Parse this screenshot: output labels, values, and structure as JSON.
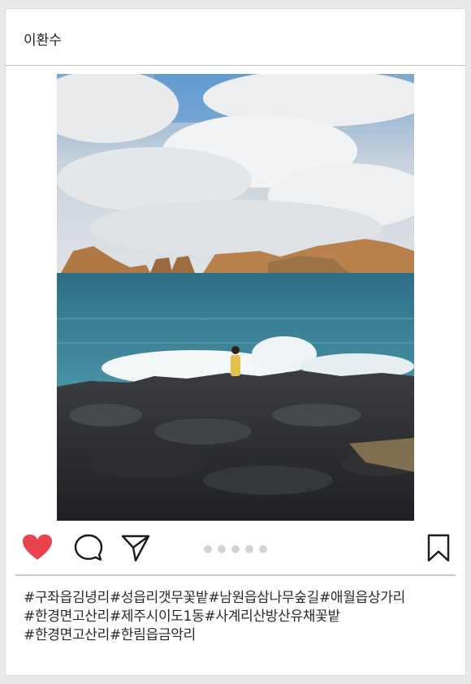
{
  "post": {
    "username": "이환수"
  },
  "carousel": {
    "total": 5,
    "active_index": null
  },
  "colors": {
    "like": "#e8434f",
    "icon": "#1a1a1a",
    "dot": "#d3d3d3"
  },
  "icons": {
    "like": "heart-icon",
    "comment": "comment-icon",
    "share": "send-icon",
    "save": "bookmark-icon"
  },
  "hashtags": [
    "#구좌읍김녕리",
    "#성읍리갯무꽃밭",
    "#남원읍삼나무숲길",
    "#애월읍상가리",
    "#한경면고산리",
    "#제주시이도1동",
    "#사계리산방산유채꽃밭",
    "#한경면고산리",
    "#한림읍금악리"
  ]
}
